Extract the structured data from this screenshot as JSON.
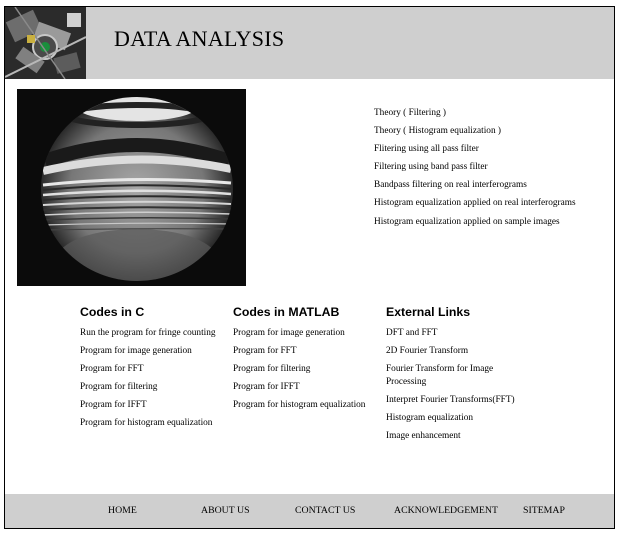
{
  "header": {
    "title": "DATA ANALYSIS"
  },
  "theory_links": [
    "Theory ( Filtering )",
    "Theory ( Histogram equalization )",
    "Flitering using all pass filter",
    "Filtering using band pass filter",
    "Bandpass filtering on real interferograms",
    "Histogram equalization applied on real interferograms",
    "Histogram equalization applied on sample images"
  ],
  "codes_c": {
    "heading": "Codes in C",
    "items": [
      "Run the program for fringe counting",
      "Program for image generation",
      "Program for FFT",
      "Program for filtering",
      "Program for IFFT",
      "Program for histogram equalization"
    ]
  },
  "codes_matlab": {
    "heading": "Codes in MATLAB",
    "items": [
      "Program for image generation",
      "Program for FFT",
      "Program for filtering",
      "Program for IFFT",
      "Program for histogram equalization"
    ]
  },
  "external_links": {
    "heading": "External Links",
    "items": [
      "DFT and FFT",
      "2D Fourier Transform",
      "Fourier Transform for Image Processing",
      "Interpret Fourier Transforms(FFT)",
      "Histogram equalization",
      "Image enhancement"
    ]
  },
  "footer": {
    "home": "HOME",
    "about": "ABOUT US",
    "contact": "CONTACT US",
    "acknowledgement": "ACKNOWLEDGEMENT",
    "sitemap": "SITEMAP"
  },
  "colors": {
    "header_bg": "#cfcfcf",
    "footer_bg": "#cfcfcf",
    "text": "#000000"
  }
}
